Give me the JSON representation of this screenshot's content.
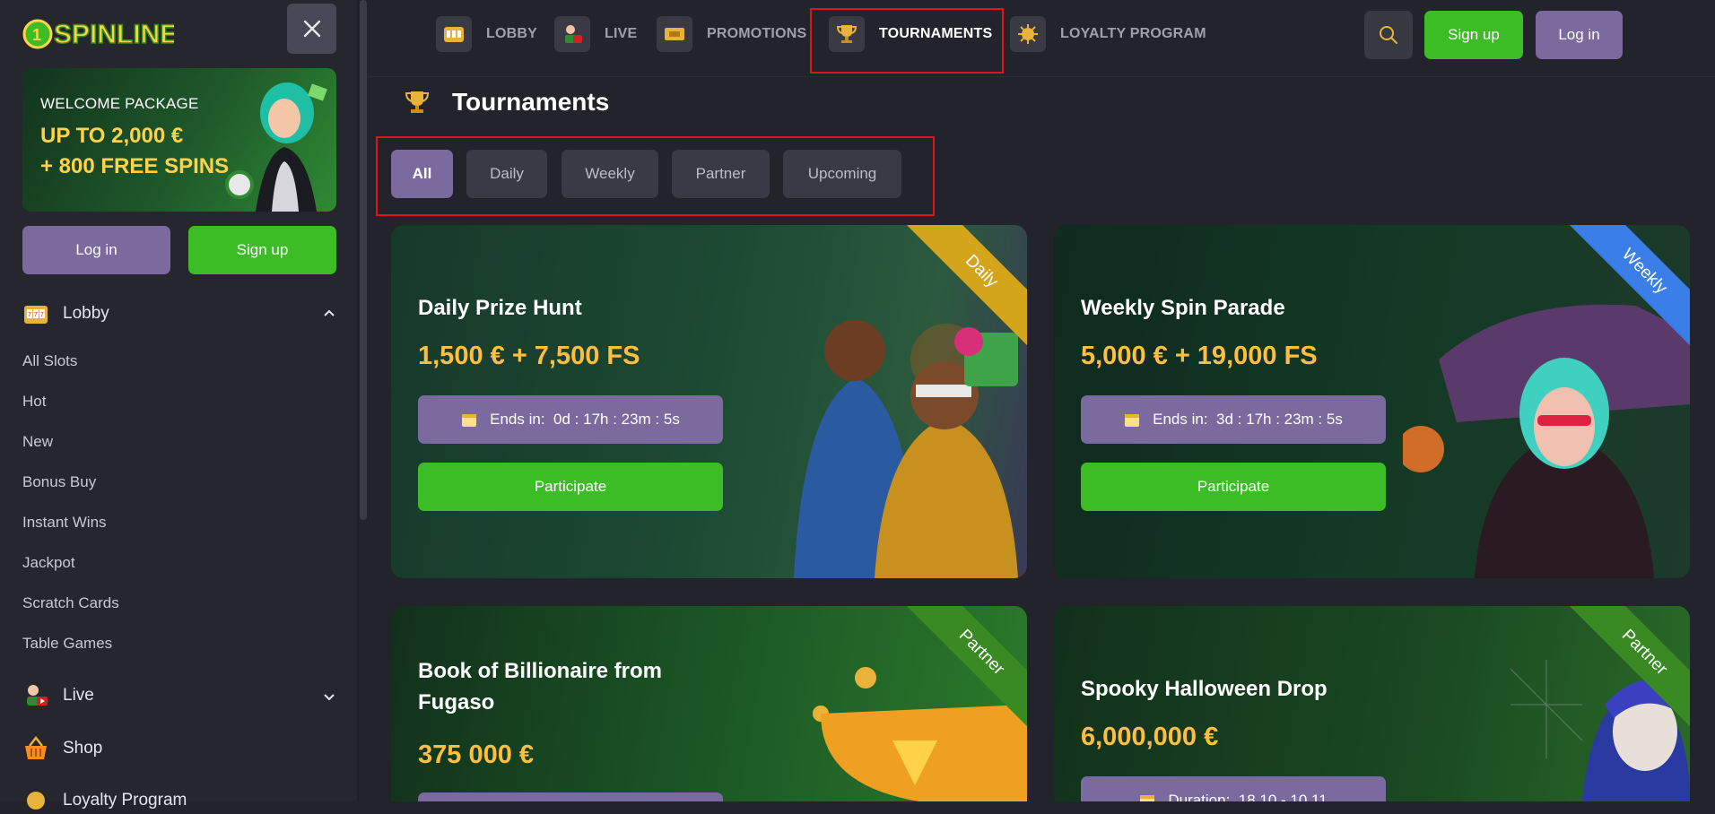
{
  "sidebar": {
    "logo_text": "SPINLINE",
    "welcome": {
      "line1": "WELCOME PACKAGE",
      "line2": "UP TO 2,000 €",
      "line3": "+ 800 FREE SPINS"
    },
    "login_label": "Log in",
    "signup_label": "Sign up",
    "lobby_label": "Lobby",
    "links": [
      "All Slots",
      "Hot",
      "New",
      "Bonus Buy",
      "Instant Wins",
      "Jackpot",
      "Scratch Cards",
      "Table Games"
    ],
    "live_label": "Live",
    "shop_label": "Shop",
    "loyalty_label": "Loyalty Program"
  },
  "nav": {
    "items": [
      {
        "label": "LOBBY",
        "icon": "slot-machine-icon"
      },
      {
        "label": "LIVE",
        "icon": "live-dealer-icon"
      },
      {
        "label": "PROMOTIONS",
        "icon": "ticket-icon"
      },
      {
        "label": "TOURNAMENTS",
        "icon": "trophy-icon"
      },
      {
        "label": "LOYALTY PROGRAM",
        "icon": "loyalty-icon"
      }
    ],
    "active": "TOURNAMENTS",
    "signup_label": "Sign up",
    "login_label": "Log in"
  },
  "page": {
    "title": "Tournaments",
    "filters": [
      "All",
      "Daily",
      "Weekly",
      "Partner",
      "Upcoming"
    ],
    "active_filter": "All"
  },
  "cards": [
    {
      "title": "Daily Prize Hunt",
      "prize": "1,500 € + 7,500 FS",
      "timer_label": "Ends in:",
      "timer_value": "0d : 17h : 23m : 5s",
      "button": "Participate",
      "badge": "Daily"
    },
    {
      "title": "Weekly Spin Parade",
      "prize": "5,000 € + 19,000 FS",
      "timer_label": "Ends in:",
      "timer_value": "3d : 17h : 23m : 5s",
      "button": "Participate",
      "badge": "Weekly"
    },
    {
      "title_line1": "Book of Billionaire from",
      "title_line2": "Fugaso",
      "prize": "375 000 €",
      "badge": "Partner"
    },
    {
      "title": "Spooky Halloween Drop",
      "prize": "6,000,000 €",
      "timer_label": "Duration:",
      "timer_value": "18.10 - 10.11",
      "badge": "Partner"
    }
  ],
  "colors": {
    "accent_purple": "#7a6a9e",
    "accent_green": "#3dbd25",
    "prize_gold": "#ffbe3f",
    "highlight_red": "#e0141b"
  }
}
